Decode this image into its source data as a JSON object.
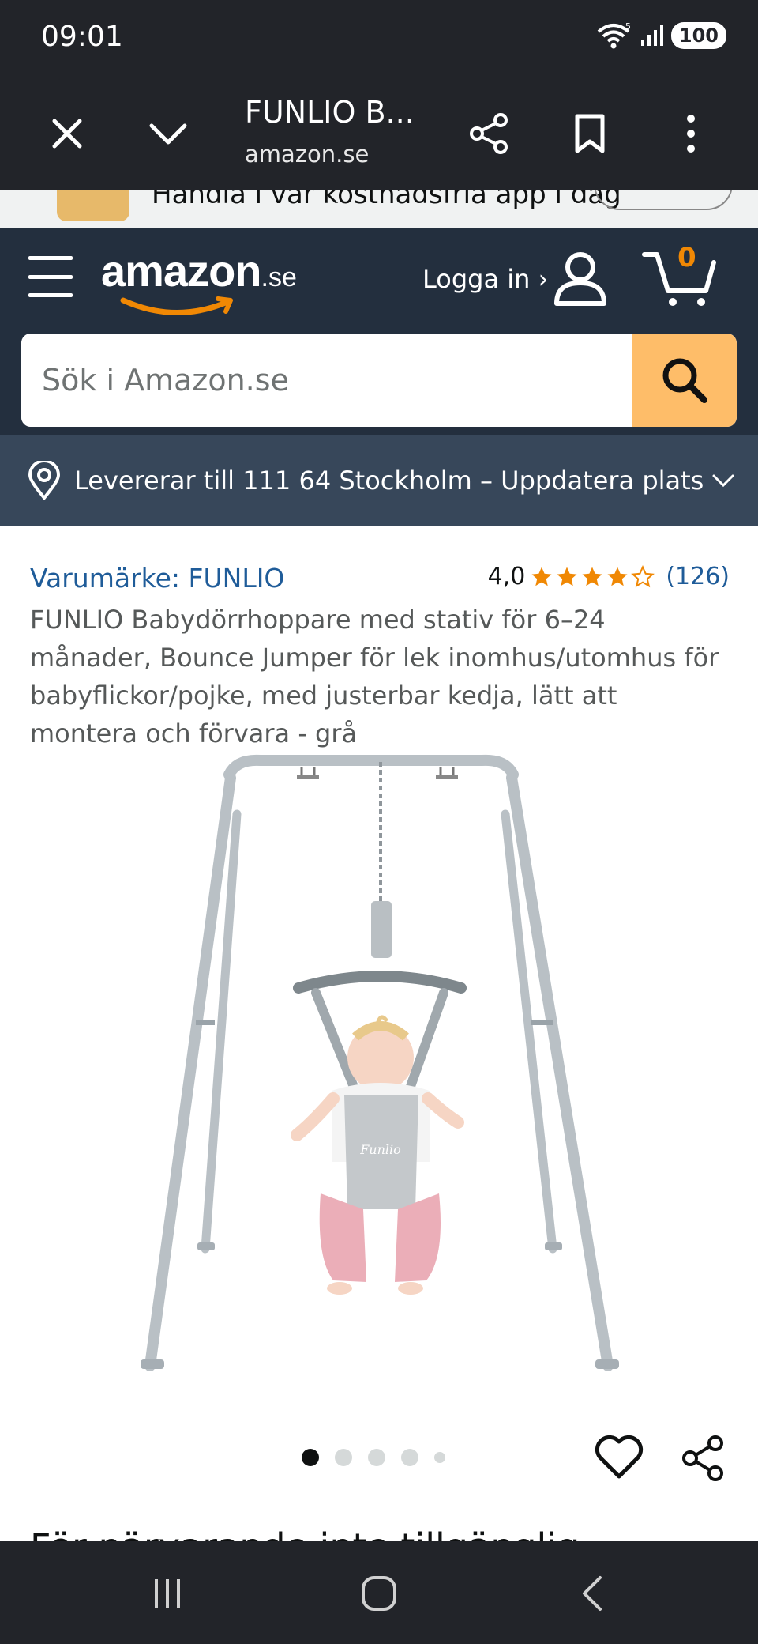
{
  "status_bar": {
    "time": "09:01",
    "battery": "100",
    "network_label": "5"
  },
  "browser": {
    "title": "FUNLIO B...",
    "url": "amazon.se"
  },
  "app_banner": {
    "text": "Handla i vår kostnadsfria app i dag"
  },
  "header": {
    "logo_main": "amazon",
    "logo_tld": ".se",
    "login_label": "Logga in ›",
    "cart_count": "0",
    "search_placeholder": "Sök i Amazon.se"
  },
  "delivery": {
    "text": "Levererar till 111 64 Stockholm – Uppdatera plats"
  },
  "product": {
    "brand": "Varumärke: FUNLIO",
    "rating": "4,0",
    "stars": 4.0,
    "rating_count": "(126)",
    "title": "FUNLIO Babydörrhoppare med stativ för 6–24 månader, Bounce Jumper för lek inomhus/utomhus för babyflickor/pojke, med justerbar kedja, lätt att montera och förvara - grå",
    "image_logo_text": "Funlio",
    "image_count": 5,
    "image_index": 1,
    "availability": "För närvarande inte tillgänglig"
  },
  "colors": {
    "header_bg": "#232f3e",
    "delivery_bg": "#37475a",
    "search_button": "#febd69",
    "link": "#1f5c99",
    "star": "#f08804",
    "browser_bg": "#222429"
  },
  "icons": {
    "close": "close-icon",
    "collapse": "chevron-down-icon",
    "share": "share-icon",
    "bookmark": "bookmark-icon",
    "more": "more-vertical-icon",
    "menu": "hamburger-menu-icon",
    "account": "user-icon",
    "cart": "cart-icon",
    "search": "search-icon",
    "location": "location-pin-icon",
    "wishlist": "heart-icon",
    "nav_recents": "recents-icon",
    "nav_home": "home-icon",
    "nav_back": "back-icon"
  }
}
